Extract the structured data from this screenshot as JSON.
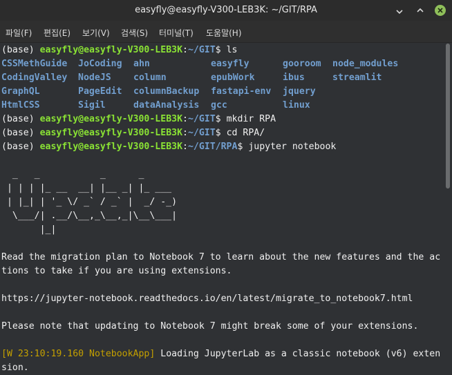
{
  "window": {
    "title": "easyfly@easyfly-V300-LEB3K: ~/GIT/RPA"
  },
  "menu": {
    "items": [
      "파일(F)",
      "편집(E)",
      "보기(V)",
      "검색(S)",
      "터미널(T)",
      "도움말(H)"
    ]
  },
  "terminal": {
    "prompt_env": "(base) ",
    "prompt_user": "easyfly@easyfly-V300-LEB3K",
    "colon": ":",
    "path_home": "~/GIT",
    "path_rpa": "~/GIT/RPA",
    "dollar": "$ ",
    "cmd_ls": "ls",
    "cmd_mkdir": "mkdir RPA",
    "cmd_cd": "cd RPA/",
    "cmd_jupyter": "jupyter notebook",
    "ls_rows": [
      [
        "CSSMethGuide",
        "JoCoding",
        "ahn",
        "easyfly",
        "gooroom",
        "node_modules"
      ],
      [
        "CodingValley",
        "NodeJS",
        "column",
        "epubWork",
        "ibus",
        "streamlit"
      ],
      [
        "GraphQL",
        "PageEdit",
        "columnBackup",
        "fastapi-env",
        "jquery",
        ""
      ],
      [
        "HtmlCSS",
        "Sigil",
        "dataAnalysis",
        "gcc",
        "linux",
        ""
      ]
    ],
    "ascii_art": [
      "  _   _           _      _",
      " | | | |_ __  __| |__ _| |_ ___",
      " | |_| | '_ \\/ _` / _` |  _/ -_)",
      "  \\___/| .__/\\__,_\\__,_|\\__\\___|",
      "       |_|"
    ],
    "msg1a": "Read the migration plan to Notebook 7 to learn about the new features and the ac",
    "msg1b": "tions to take if you are using extensions.",
    "url": "https://jupyter-notebook.readthedocs.io/en/latest/migrate_to_notebook7.html",
    "msg2": "Please note that updating to Notebook 7 might break some of your extensions.",
    "log_tag": "[W 23:10:19.160 NotebookApp]",
    "log_msg_a": " Loading JupyterLab as a classic notebook (v6) exten",
    "log_msg_b": "sion."
  },
  "colors": {
    "prompt_green": "#8ae234",
    "dir_blue": "#729fcf",
    "warn_yellow": "#c4a000",
    "text": "#f0f0f0",
    "background": "#2f3134"
  }
}
